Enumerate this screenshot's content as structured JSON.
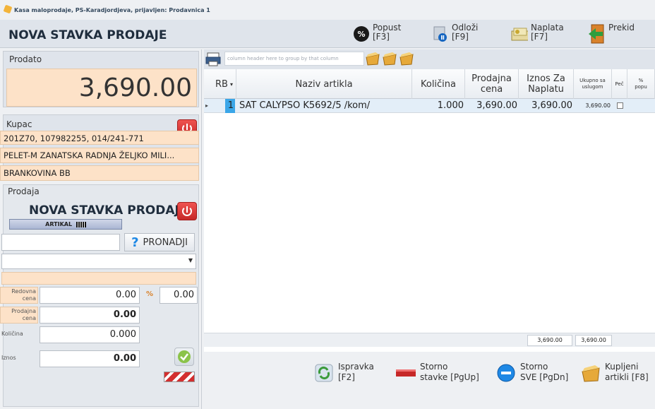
{
  "window": {
    "title": "Kasa maloprodaje, PS-Karadjordjeva, prijavljen: Prodavnica 1"
  },
  "header": {
    "title": "NOVA STAVKA PRODAJE",
    "buttons": [
      {
        "label": "Popust\n[F3]",
        "icon": "discount-icon"
      },
      {
        "label": "Odloži\n[F9]",
        "icon": "pause-icon"
      },
      {
        "label": "Naplata\n[F7]",
        "icon": "cash-icon"
      },
      {
        "label": "Prekid",
        "icon": "exit-icon"
      }
    ]
  },
  "left": {
    "prodato": {
      "label": "Prodato",
      "value": "3,690.00"
    },
    "kupac": {
      "label": "Kupac",
      "lines": [
        "201Z70, 107982255, 014/241-771",
        "PELET-M ZANATSKA RADNJA ŽELJKO MILI...",
        "BRANKOVINA BB"
      ]
    },
    "prodaja": {
      "label": "Prodaja",
      "title": "NOVA STAVKA PRODAJE",
      "artikal_label": "ARTIKAL",
      "search_value": "",
      "pronadji_label": "PRONADJI",
      "select_value": "",
      "redovna_label": "Redovna\ncena",
      "redovna_value": "0.00",
      "percent_symbol": "%",
      "percent_value": "0.00",
      "prodajna_label": "Prodajna\ncena",
      "prodajna_value": "0.00",
      "kolicina_label": "Količina",
      "kolicina_value": "0.000",
      "iznos_label": "Iznos",
      "iznos_value": "0.00"
    }
  },
  "grid": {
    "group_hint": "column header here to group by that column",
    "columns": [
      "RB",
      "Naziv artikla",
      "Količina",
      "Prodajna\ncena",
      "Iznos Za\nNaplatu",
      "Ukupno sa\nuslugom",
      "Peč",
      "%\npopu"
    ],
    "rows": [
      {
        "rb": "1",
        "naziv": "SAT CALYPSO K5692/5 /kom/",
        "kolicina": "1.000",
        "prodajna": "3,690.00",
        "iznos": "3,690.00",
        "ukupno": "3,690.00"
      }
    ],
    "footer": {
      "iznos_total": "3,690.00",
      "ukupno_total": "3,690.00"
    }
  },
  "bottom_buttons": [
    {
      "label": "Ispravka\n[F2]",
      "icon": "refresh-icon"
    },
    {
      "label": "Storno\nstavke [PgUp]",
      "icon": "minus-bar-icon"
    },
    {
      "label": "Storno\nSVE [PgDn]",
      "icon": "minus-circle-icon"
    },
    {
      "label": "Kupljeni\nartikli [F8]",
      "icon": "cart-icon"
    }
  ],
  "colors": {
    "header_bg": "#dfe4eb",
    "orange_field": "#fde2c8",
    "red_button": "#d32f2f",
    "selected_row": "#e3eef8"
  }
}
